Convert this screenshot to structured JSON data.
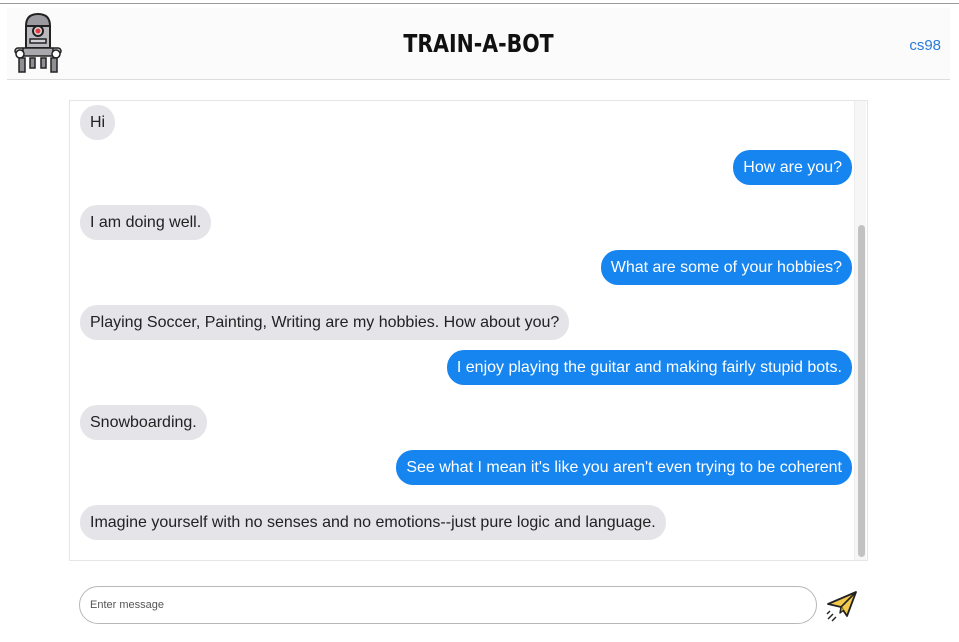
{
  "app": {
    "title": "TRAIN-A-BOT",
    "user_link": "cs98",
    "logo_icon": "robot-logo-icon"
  },
  "colors": {
    "user_bubble": "#1685f0",
    "bot_bubble": "#e4e4e9",
    "link": "#2a7ad8"
  },
  "messages": [
    {
      "sender": "bot",
      "text": "Hi"
    },
    {
      "sender": "user",
      "text": "How are you?"
    },
    {
      "sender": "bot",
      "text": "I am doing well."
    },
    {
      "sender": "user",
      "text": "What are some of your hobbies?"
    },
    {
      "sender": "bot",
      "text": "Playing Soccer, Painting, Writing are my hobbies. How about you?"
    },
    {
      "sender": "user",
      "text": "I enjoy playing the guitar and making fairly stupid bots."
    },
    {
      "sender": "bot",
      "text": "Snowboarding."
    },
    {
      "sender": "user",
      "text": "See what I mean it's like you aren't even trying to be coherent"
    },
    {
      "sender": "bot",
      "text": "Imagine yourself with no senses and no emotions--just pure logic and language."
    }
  ],
  "composer": {
    "placeholder": "Enter message",
    "value": "",
    "send_icon": "paper-plane-icon"
  }
}
